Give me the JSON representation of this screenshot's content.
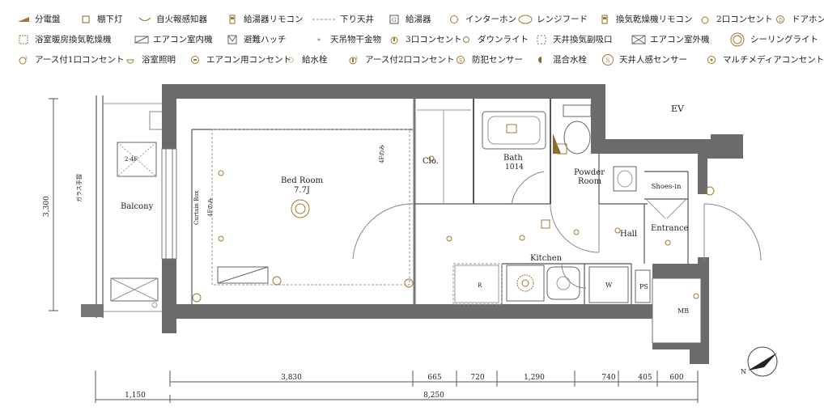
{
  "legend": [
    {
      "icon": "distribution-board-icon",
      "label": "分電盤"
    },
    {
      "icon": "downlight-box-icon",
      "label": "棚下灯"
    },
    {
      "icon": "fire-alarm-icon",
      "label": "自火報感知器"
    },
    {
      "icon": "water-heater-remote-icon",
      "label": "給湯器リモコン"
    },
    {
      "icon": "dropped-ceiling-icon",
      "label": "下り天井"
    },
    {
      "icon": "water-heater-icon",
      "label": "給湯器"
    },
    {
      "icon": "intercom-icon",
      "label": "インターホン"
    },
    {
      "icon": "range-hood-icon",
      "label": "レンジフード"
    },
    {
      "icon": "dryer-remote-icon",
      "label": "換気乾燥機リモコン"
    },
    {
      "icon": "outlet-2-icon",
      "label": "2口コンセント"
    },
    {
      "icon": "door-phone-icon",
      "label": "ドアホン"
    },
    {
      "icon": "bath-dryer-icon",
      "label": "浴室暖房換気乾燥機"
    },
    {
      "icon": "indoor-ac-icon",
      "label": "エアコン室内機"
    },
    {
      "icon": "escape-hatch-icon",
      "label": "避難ハッチ"
    },
    {
      "icon": "ceiling-hanger-icon",
      "label": "天吊物干金物"
    },
    {
      "icon": "outlet-3-icon",
      "label": "3口コンセント"
    },
    {
      "icon": "downlight-icon",
      "label": "ダウンライト"
    },
    {
      "icon": "ceiling-vent-icon",
      "label": "天井換気副吸口"
    },
    {
      "icon": "outdoor-ac-icon",
      "label": "エアコン室外機"
    },
    {
      "icon": "ceiling-light-icon",
      "label": "シーリングライト"
    },
    {
      "icon": "earth-outlet-1-icon",
      "label": "アース付1口コンセント"
    },
    {
      "icon": "bath-light-icon",
      "label": "浴室照明"
    },
    {
      "icon": "ac-outlet-icon",
      "label": "エアコン用コンセント"
    },
    {
      "icon": "water-tap-icon",
      "label": "給水栓"
    },
    {
      "icon": "earth-outlet-2-icon",
      "label": "アース付2口コンセント"
    },
    {
      "icon": "security-sensor-icon",
      "label": "防犯センサー"
    },
    {
      "icon": "mixing-tap-icon",
      "label": "混合水栓"
    },
    {
      "icon": "motion-sensor-icon",
      "label": "天井人感センサー"
    },
    {
      "icon": "multimedia-outlet-icon",
      "label": "マルチメディアコンセント"
    }
  ],
  "rooms": {
    "ev": "EV",
    "balcony": "Balcony",
    "bedroom": "Bed Room",
    "bedroom_size": "7.7J",
    "closet": "Clo.",
    "bath": "Bath",
    "bath_size": "1014",
    "powder": "Powder",
    "powder2": "Room",
    "shoes": "Shoes-in",
    "hall": "Hall",
    "entrance": "Entrance",
    "kitchen": "Kitchen",
    "washer": "W",
    "ps": "PS",
    "mb": "MB",
    "fridge": "R"
  },
  "annotations": {
    "height": "3,300",
    "glass_rail": "ガラス手摺",
    "curtain_box": "Curtain Box",
    "fourf_only_a": "4Fのみ",
    "fourf_only_b": "4Fのみ",
    "hatch_label": "2-4F",
    "north": "N"
  },
  "dimensions": {
    "top": [
      "3,830",
      "665",
      "720",
      "1,290",
      "740",
      "405",
      "600"
    ],
    "bottom": [
      "1,150",
      "8,250"
    ]
  }
}
